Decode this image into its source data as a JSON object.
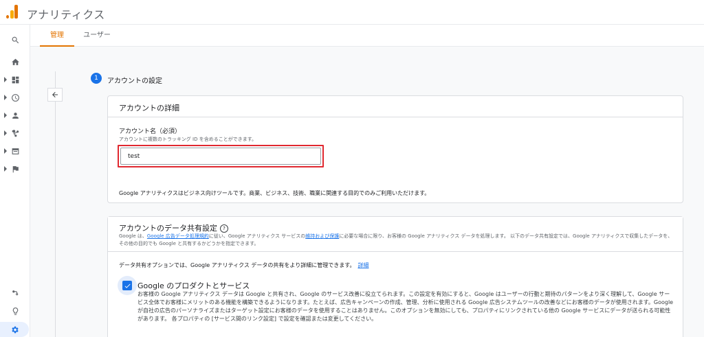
{
  "app": {
    "title": "アナリティクス",
    "brand_colors": [
      "#f9ab00",
      "#e37400"
    ]
  },
  "rail": {
    "items": [
      {
        "icon": "search-icon"
      },
      {
        "icon": "home-icon"
      },
      {
        "icon": "dashboard-icon"
      },
      {
        "icon": "clock-icon"
      },
      {
        "icon": "person-icon"
      },
      {
        "icon": "branch-icon"
      },
      {
        "icon": "table-icon"
      },
      {
        "icon": "flag-icon"
      },
      {
        "icon": "share-icon"
      },
      {
        "icon": "lightbulb-icon"
      },
      {
        "icon": "gear-icon"
      }
    ]
  },
  "tabs": [
    {
      "label": "管理",
      "active": true
    },
    {
      "label": "ユーザー",
      "active": false
    }
  ],
  "step": {
    "number": "1",
    "title": "アカウントの設定"
  },
  "account_details": {
    "heading": "アカウントの詳細",
    "field_label": "アカウント名（必須）",
    "field_help": "アカウントに複数のトラッキング ID を含めることができます。",
    "field_value": "test",
    "note": "Google アナリティクスはビジネス向けツールです。商業、ビジネス、技術、職業に関連する目的でのみご利用いただけます。"
  },
  "data_sharing": {
    "heading": "アカウントのデータ共有設定",
    "desc_pre": "Google は、",
    "desc_link1": "Google 広告データ処理規約",
    "desc_mid": "に従い、Google アナリティクス サービスの",
    "desc_link2": "維持および保護",
    "desc_post": "に必要な場合に限り、お客様の Google アナリティクス データを処理します。 以下のデータ共有設定では、Google アナリティクスで収集したデータを、その他の目的でも Google と共有するかどうかを指定できます。",
    "options_text": "データ共有オプションでは、Google アナリティクス データの共有をより詳細に管理できます。",
    "options_link": "詳細",
    "option1": {
      "title": "Google のプロダクトとサービス",
      "checked": true,
      "description": "お客様の Google アナリティクス データは Google と共有され、Google のサービス改善に役立てられます。この設定を有効にすると、Google はユーザーの行動と期待のパターンをより深く理解して、Google サービス全体でお客様にメリットのある機能を構築できるようになります。たとえば、広告キャンペーンの作成、管理、分析に使用される Google 広告システムツールの改善などにお客様のデータが使用されます。Google が自社の広告のパーソナライズまたはターゲット設定にお客様のデータを使用することはありません。このオプションを無効にしても、プロパティにリンクされている他の Google サービスにデータが送られる可能性があります。 各プロパティの [サービス間のリンク設定] で設定を確認または変更してください。"
    }
  }
}
